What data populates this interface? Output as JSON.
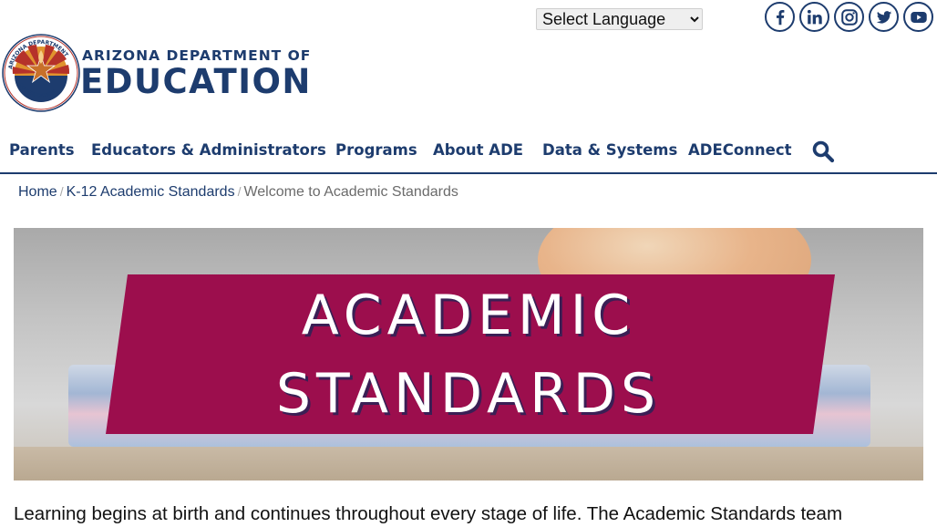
{
  "language_select": {
    "selected": "Select Language"
  },
  "social": [
    {
      "icon": "facebook-icon",
      "letters": "f"
    },
    {
      "icon": "linkedin-icon",
      "letters": "in"
    },
    {
      "icon": "instagram-icon"
    },
    {
      "icon": "twitter-icon"
    },
    {
      "icon": "youtube-icon"
    }
  ],
  "logo": {
    "line1": "ARIZONA DEPARTMENT OF",
    "line2": "EDUCATION",
    "seal_text": "ARIZONA DEPARTMENT OF EDUCATION"
  },
  "nav": {
    "items": [
      "Parents",
      "Educators & Administrators",
      "Programs",
      "About ADE",
      "Data & Systems",
      "ADEConnect"
    ],
    "search_icon": "search-icon"
  },
  "breadcrumb": {
    "home": "Home",
    "parent": "K-12 Academic Standards",
    "current": "Welcome to Academic Standards",
    "separator": "/"
  },
  "hero": {
    "line1": "ACADEMIC",
    "line2": "STANDARDS"
  },
  "intro_text": "Learning begins at birth and continues throughout every stage of life. The Academic Standards team",
  "colors": {
    "brand_navy": "#1d3c6e",
    "banner_maroon": "#9c0e4d",
    "seal_red": "#b5322a",
    "seal_gold": "#e0932e"
  }
}
